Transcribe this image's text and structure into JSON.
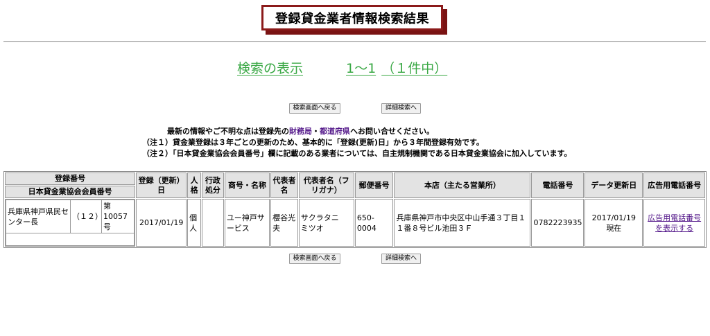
{
  "header": {
    "title": "登録貸金業者情報検索結果"
  },
  "summary": {
    "label": "検索の表示",
    "range": "1〜1",
    "count": "（１件中）"
  },
  "buttons": {
    "back": "検索画面へ戻る",
    "detail": "詳細検索へ"
  },
  "notes": {
    "line1_a": "最新の情報やご不明な点は登録先の",
    "link1": "財務局",
    "sep": "・",
    "link2": "都道府県",
    "line1_b": "へお問い合せください。",
    "line2": "（注１）貸金業登録は３年ごとの更新のため、基本的に「登録(更新)日」から３年間登録有効です。",
    "line3": "（注２）「日本貸金業協会会員番号」欄に記載のある業者については、自主規制機関である日本貸金業協会に加入しています。"
  },
  "table": {
    "headers": {
      "reg_no": "登録番号",
      "assoc_no": "日本貸金業協会会員番号",
      "reg_date": "登録（更新）日",
      "personality": "人格",
      "admin": "行政処分",
      "trade_name": "商号・名称",
      "rep": "代表者名",
      "rep_kana": "代表者名（フリガナ）",
      "zip": "郵便番号",
      "address": "本店（主たる営業所）",
      "phone": "電話番号",
      "updated": "データ更新日",
      "ad_phone": "広告用電話番号"
    },
    "rows": [
      {
        "authority": "兵庫県神戸県民センター長",
        "renewal": "（１２）",
        "number": "第10057号",
        "assoc_no": "",
        "reg_date": "2017/01/19",
        "personality": "個人",
        "admin": "",
        "trade_name": "ユー神戸サービス",
        "rep": "櫻谷光夫",
        "rep_kana": "サクラタニ　ミツオ",
        "zip": "650-0004",
        "address": "兵庫県神戸市中央区中山手通３丁目１１番８号ビル池田３Ｆ",
        "phone": "0782223935",
        "updated": "2017/01/19 現在",
        "ad_phone": "広告用電話番号を表示する"
      }
    ]
  }
}
